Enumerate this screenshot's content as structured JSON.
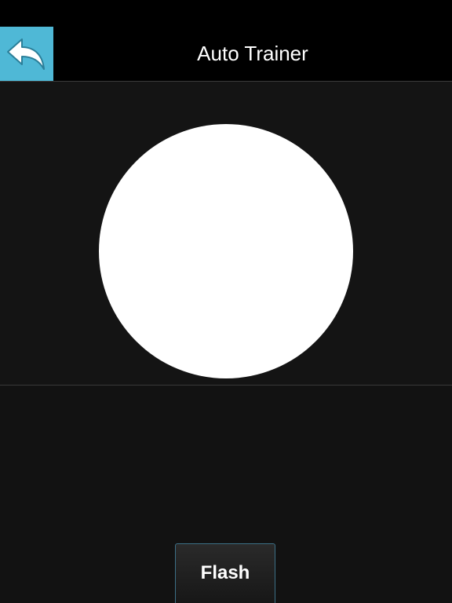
{
  "header": {
    "title": "Auto Trainer",
    "back_icon": "back-arrow-icon"
  },
  "stimulus": {
    "shape": "circle",
    "color": "#ffffff"
  },
  "controls": {
    "flash_label": "Flash"
  },
  "colors": {
    "accent": "#4fb8d6",
    "background": "#141414"
  }
}
